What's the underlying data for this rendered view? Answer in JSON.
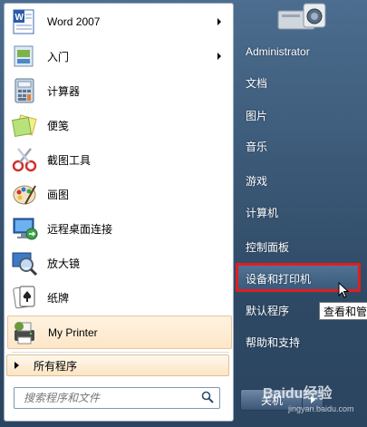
{
  "left_programs": [
    {
      "label": "Word 2007",
      "icon": "word-icon",
      "submenu": true
    },
    {
      "label": "入门",
      "icon": "getting-started-icon",
      "submenu": true
    },
    {
      "label": "计算器",
      "icon": "calculator-icon",
      "submenu": false
    },
    {
      "label": "便笺",
      "icon": "sticky-notes-icon",
      "submenu": false
    },
    {
      "label": "截图工具",
      "icon": "snipping-tool-icon",
      "submenu": false
    },
    {
      "label": "画图",
      "icon": "paint-icon",
      "submenu": false
    },
    {
      "label": "远程桌面连接",
      "icon": "remote-desktop-icon",
      "submenu": false
    },
    {
      "label": "放大镜",
      "icon": "magnifier-icon",
      "submenu": false
    },
    {
      "label": "纸牌",
      "icon": "solitaire-icon",
      "submenu": false
    }
  ],
  "pinned_item": {
    "label": "My Printer",
    "icon": "printer-icon"
  },
  "all_programs": {
    "label": "所有程序"
  },
  "search": {
    "placeholder": "搜索程序和文件"
  },
  "right_items": [
    {
      "label": "Administrator"
    },
    {
      "label": "文档"
    },
    {
      "label": "图片"
    },
    {
      "label": "音乐"
    },
    {
      "label": "游戏"
    },
    {
      "label": "计算机"
    },
    {
      "label": "控制面板"
    },
    {
      "label": "设备和打印机"
    },
    {
      "label": "默认程序"
    },
    {
      "label": "帮助和支持"
    }
  ],
  "tooltip": {
    "text": "查看和管"
  },
  "shutdown": {
    "label": "关机"
  },
  "watermark": {
    "text": "Baidu经验",
    "sub": "jingyan.baidu.com"
  },
  "colors": {
    "highlight_border": "#e01e1e",
    "menu_background": "#2e4964"
  }
}
